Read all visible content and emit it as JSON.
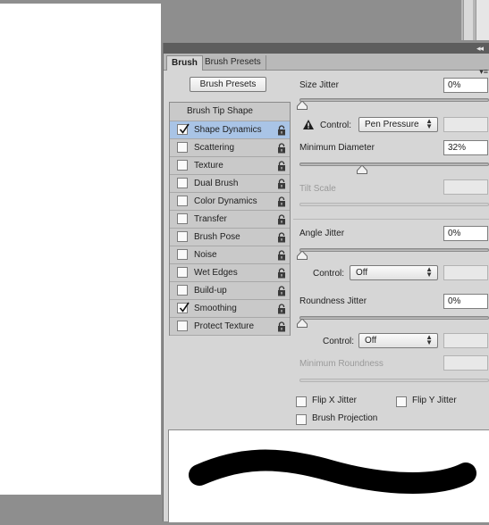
{
  "tabs": {
    "active": "Brush",
    "inactive": "Brush Presets"
  },
  "presets_button": "Brush Presets",
  "list": {
    "header": "Brush Tip Shape",
    "items": [
      {
        "label": "Shape Dynamics",
        "checked": true
      },
      {
        "label": "Scattering",
        "checked": false
      },
      {
        "label": "Texture",
        "checked": false
      },
      {
        "label": "Dual Brush",
        "checked": false
      },
      {
        "label": "Color Dynamics",
        "checked": false
      },
      {
        "label": "Transfer",
        "checked": false
      },
      {
        "label": "Brush Pose",
        "checked": false
      },
      {
        "label": "Noise",
        "checked": false
      },
      {
        "label": "Wet Edges",
        "checked": false
      },
      {
        "label": "Build-up",
        "checked": false
      },
      {
        "label": "Smoothing",
        "checked": true
      },
      {
        "label": "Protect Texture",
        "checked": false
      }
    ]
  },
  "settings": {
    "size_jitter": {
      "label": "Size Jitter",
      "value": "0%",
      "slider_fraction": 0.0
    },
    "size_control": {
      "label": "Control:",
      "value": "Pen Pressure",
      "warning_icon": "warning-icon"
    },
    "min_diameter": {
      "label": "Minimum Diameter",
      "value": "32%",
      "slider_fraction": 0.32
    },
    "tilt_scale": {
      "label": "Tilt Scale"
    },
    "angle_jitter": {
      "label": "Angle Jitter",
      "value": "0%",
      "slider_fraction": 0.0
    },
    "angle_control": {
      "label": "Control:",
      "value": "Off"
    },
    "roundness_jitter": {
      "label": "Roundness Jitter",
      "value": "0%",
      "slider_fraction": 0.0
    },
    "roundness_control": {
      "label": "Control:",
      "value": "Off"
    },
    "min_roundness": {
      "label": "Minimum Roundness"
    },
    "flip_x": {
      "label": "Flip X Jitter",
      "checked": false
    },
    "flip_y": {
      "label": "Flip Y Jitter",
      "checked": false
    },
    "brush_projection": {
      "label": "Brush Projection",
      "checked": false
    }
  },
  "icons": {
    "lock": "lock-icon",
    "collapse": "double-chevron-icon",
    "menu": "panel-menu-icon"
  },
  "colors": {
    "selected_row": "#a9c4e6",
    "panel_bg": "#d6d6d6",
    "app_bg": "#8e8e8e"
  }
}
